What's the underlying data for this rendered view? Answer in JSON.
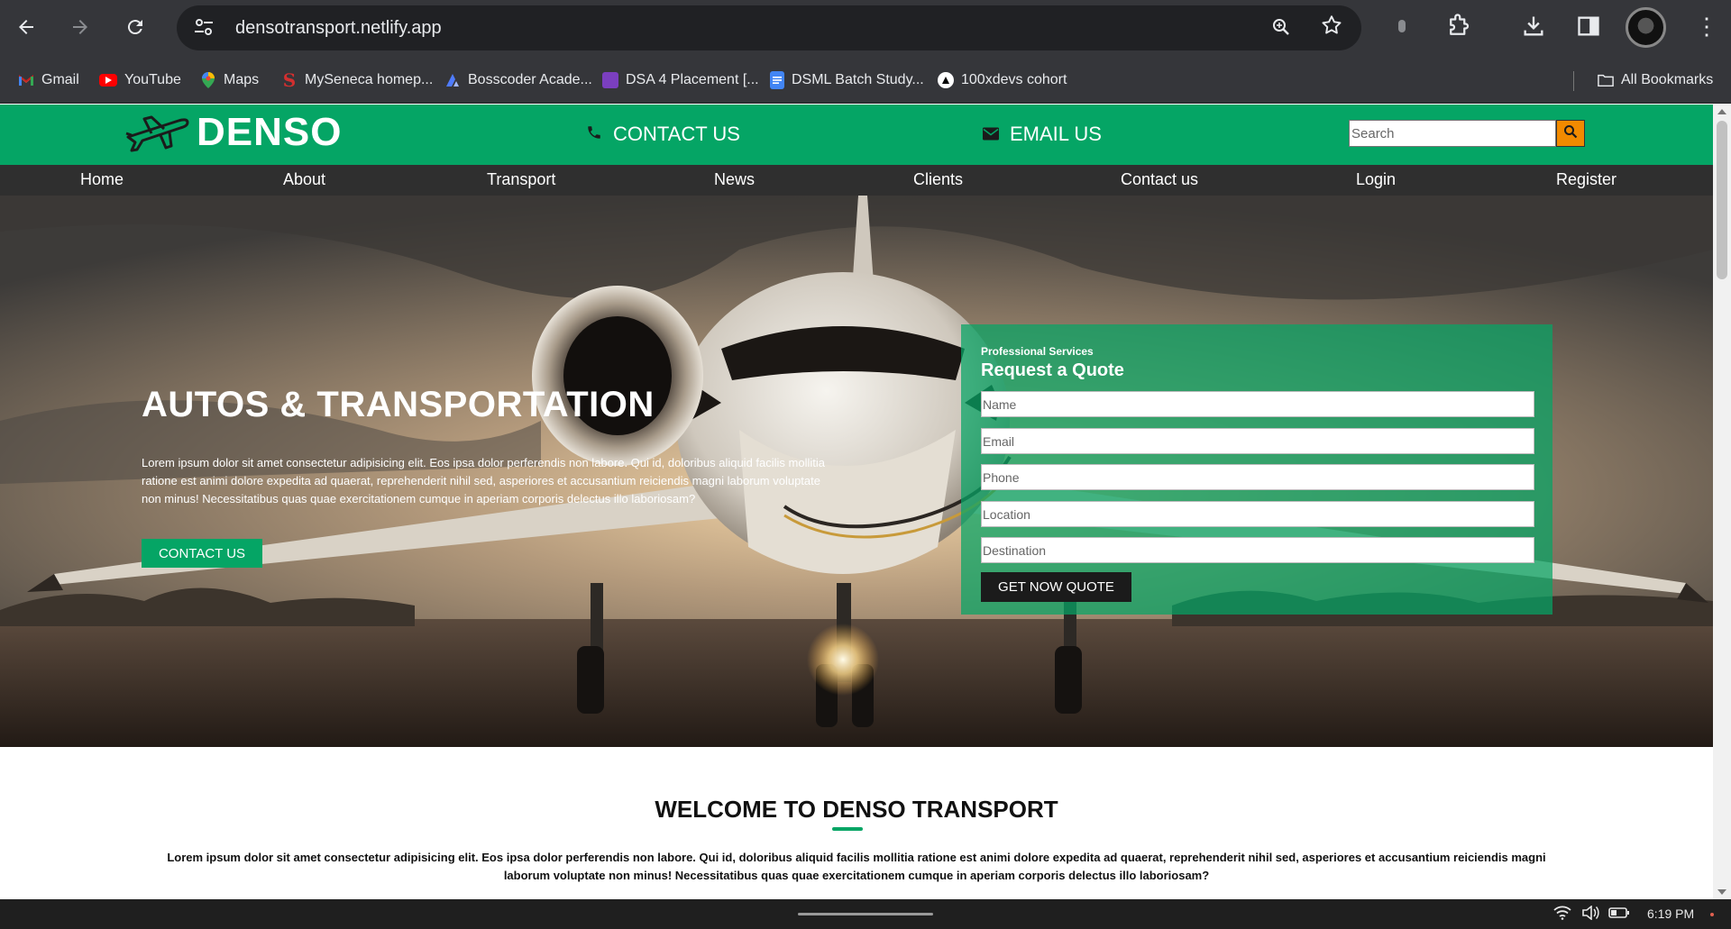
{
  "browser": {
    "url": "densotransport.netlify.app",
    "icons": [
      "back-arrow-icon",
      "forward-arrow-icon",
      "reload-icon",
      "site-settings-icon",
      "zoom-icon",
      "bookmark-star-icon",
      "extension-icon",
      "extensions-puzzle-icon",
      "download-icon",
      "side-panel-icon",
      "profile-avatar",
      "more-menu-icon"
    ]
  },
  "bookmarks": {
    "items": [
      {
        "label": "Gmail",
        "icon": "gmail-icon",
        "color": "#ea4335"
      },
      {
        "label": "YouTube",
        "icon": "youtube-icon",
        "color": "#ff0000"
      },
      {
        "label": "Maps",
        "icon": "maps-pin-icon",
        "color": "#34a853"
      },
      {
        "label": "MySeneca homep...",
        "icon": "seneca-icon",
        "color": "#d32f2f"
      },
      {
        "label": "Bosscoder Acade...",
        "icon": "bosscoder-icon",
        "color": "#4f7cff"
      },
      {
        "label": "DSA 4 Placement [...",
        "icon": "dsa-icon",
        "color": "#7b3fbf"
      },
      {
        "label": "DSML Batch Study...",
        "icon": "google-docs-icon",
        "color": "#4285f4"
      },
      {
        "label": "100xdevs cohort",
        "icon": "100xdevs-icon",
        "color": "#000000"
      }
    ],
    "all_label": "All Bookmarks"
  },
  "header": {
    "logo": "DENSO",
    "contact": "CONTACT US",
    "email": "EMAIL US",
    "search_placeholder": "Search",
    "brand_color": "#05a565",
    "accent_color": "#f28a00"
  },
  "nav": {
    "items": [
      "Home",
      "About",
      "Transport",
      "News",
      "Clients",
      "Contact us",
      "Login",
      "Register"
    ]
  },
  "hero": {
    "title": "AUTOS & TRANSPORTATION",
    "text": "Lorem ipsum dolor sit amet consectetur adipisicing elit. Eos ipsa dolor perferendis non labore. Qui id, doloribus aliquid facilis mollitia ratione est animi dolore expedita ad quaerat, reprehenderit nihil sed, asperiores et accusantium reiciendis magni laborum voluptate non minus! Necessitatibus quas quae exercitationem cumque in aperiam corporis delectus illo laboriosam?",
    "button": "CONTACT US"
  },
  "quote": {
    "eyebrow": "Professional Services",
    "title": "Request a Quote",
    "fields": [
      "Name",
      "Email",
      "Phone",
      "Location",
      "Destination"
    ],
    "button": "GET NOW QUOTE"
  },
  "welcome": {
    "title": "WELCOME TO DENSO TRANSPORT",
    "text": "Lorem ipsum dolor sit amet consectetur adipisicing elit. Eos ipsa dolor perferendis non labore. Qui id, doloribus aliquid facilis mollitia ratione est animi dolore expedita ad quaerat, reprehenderit nihil sed, asperiores et accusantium reiciendis magni laborum voluptate non minus! Necessitatibus quas quae exercitationem cumque in aperiam corporis delectus illo laboriosam?"
  },
  "taskbar": {
    "time": "6:19 PM"
  }
}
